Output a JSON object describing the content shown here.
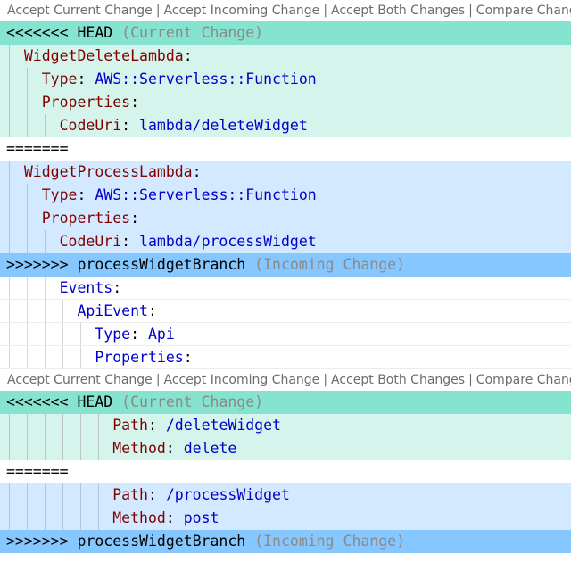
{
  "codelens": {
    "accept_current": "Accept Current Change",
    "accept_incoming": "Accept Incoming Change",
    "accept_both": "Accept Both Changes",
    "compare": "Compare Changes",
    "separator": "|"
  },
  "conflict1": {
    "head_marker": "<<<<<<<",
    "head_label": "HEAD",
    "current_hint": "(Current Change)",
    "current": {
      "l1_key": "WidgetDeleteLambda",
      "l2_key": "Type",
      "l2_val": "AWS::Serverless::Function",
      "l3_key": "Properties",
      "l4_key": "CodeUri",
      "l4_val": "lambda/deleteWidget"
    },
    "divider": "=======",
    "incoming": {
      "l1_key": "WidgetProcessLambda",
      "l2_key": "Type",
      "l2_val": "AWS::Serverless::Function",
      "l3_key": "Properties",
      "l4_key": "CodeUri",
      "l4_val": "lambda/processWidget"
    },
    "inc_marker": ">>>>>>>",
    "inc_branch": "processWidgetBranch",
    "incoming_hint": "(Incoming Change)"
  },
  "plain": {
    "events_key": "Events",
    "apievent_key": "ApiEvent",
    "type_key": "Type",
    "type_val": "Api",
    "properties_key": "Properties"
  },
  "conflict2": {
    "head_marker": "<<<<<<<",
    "head_label": "HEAD",
    "current_hint": "(Current Change)",
    "current": {
      "path_key": "Path",
      "path_val": "/deleteWidget",
      "method_key": "Method",
      "method_val": "delete"
    },
    "divider": "=======",
    "incoming": {
      "path_key": "Path",
      "path_val": "/processWidget",
      "method_key": "Method",
      "method_val": "post"
    },
    "inc_marker": ">>>>>>>",
    "inc_branch": "processWidgetBranch",
    "incoming_hint": "(Incoming Change)"
  },
  "colors": {
    "head_marker_bg": "#85e3cf",
    "current_bg": "#d4f4ec",
    "incoming_bg": "#d2e9ff",
    "incoming_marker_bg": "#86c7ff",
    "key_color": "#800000",
    "value_color": "#0000cc"
  }
}
